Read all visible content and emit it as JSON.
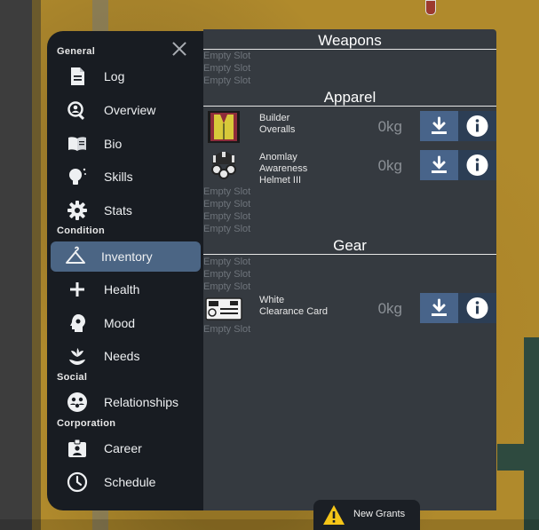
{
  "sidebar": {
    "sections": {
      "general": "General",
      "condition": "Condition",
      "social": "Social",
      "corporation": "Corporation"
    },
    "items": {
      "log": "Log",
      "overview": "Overview",
      "bio": "Bio",
      "skills": "Skills",
      "stats": "Stats",
      "inventory": "Inventory",
      "health": "Health",
      "mood": "Mood",
      "needs": "Needs",
      "relationships": "Relationships",
      "career": "Career",
      "schedule": "Schedule"
    },
    "active_item": "Inventory"
  },
  "inventory": {
    "weapons": {
      "title": "Weapons",
      "empty_slots": [
        "Empty Slot",
        "Empty Slot",
        "Empty Slot"
      ]
    },
    "apparel": {
      "title": "Apparel",
      "items": [
        {
          "name_lines": [
            "Builder",
            "Overalls"
          ],
          "weight": "0kg",
          "icon": "overalls-icon"
        },
        {
          "name_lines": [
            "Anomlay",
            "Awareness",
            "Helmet III"
          ],
          "weight": "0kg",
          "icon": "helmet-icon"
        }
      ],
      "empty_slots": [
        "Empty Slot",
        "Empty Slot",
        "Empty Slot",
        "Empty Slot"
      ]
    },
    "gear": {
      "title": "Gear",
      "empty_slots_top": [
        "Empty Slot",
        "Empty Slot",
        "Empty Slot"
      ],
      "items": [
        {
          "name_lines": [
            "White",
            "Clearance Card"
          ],
          "weight": "0kg",
          "icon": "clearance-card-icon"
        }
      ],
      "empty_slots_bottom": [
        "Empty Slot"
      ]
    }
  },
  "notification": {
    "label": "New Grants",
    "icon": "warning-icon"
  },
  "colors": {
    "sidebar_bg": "#181c22",
    "panel_bg": "#353a40",
    "active_item_bg": "#4b6584",
    "unequip_button_bg": "#48648a",
    "info_button_bg": "#2c3e55",
    "warning_yellow": "#f5c518"
  }
}
